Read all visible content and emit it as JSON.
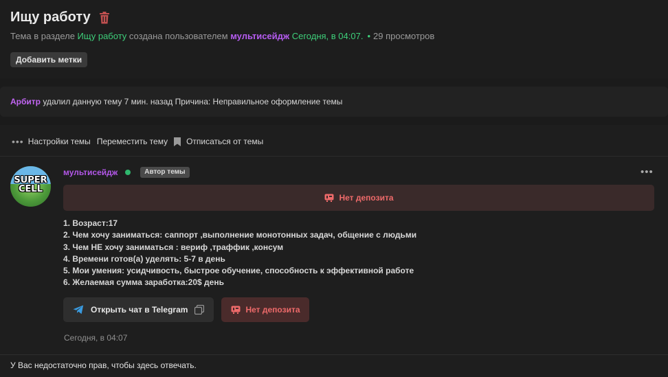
{
  "thread": {
    "title": "Ищу работу",
    "meta": {
      "prefix": "Тема в разделе ",
      "section": "Ищу работу",
      "created_by": " создана пользователем ",
      "author": "мультисейдж",
      "time": " Сегодня, в 04:07.",
      "views": "29 просмотров"
    },
    "add_tags_label": "Добавить метки"
  },
  "notice": {
    "moderator": "Арбитр",
    "text": " удалил данную тему 7 мин. назад Причина: Неправильное оформление темы"
  },
  "toolbar": {
    "settings_label": "Настройки темы",
    "move_label": "Переместить тему",
    "unsubscribe_label": "Отписаться от темы"
  },
  "post": {
    "author": "мультисейдж",
    "avatar_text": "SUPER CELL",
    "badge": "Автор темы",
    "deposit_banner": "Нет депозита",
    "lines": [
      "1. Возраст:17",
      "2. Чем хочу заниматься: саппорт ,выполнение монотонных задач, общение с людьми",
      "3. Чем НЕ хочу заниматься : вериф ,траффик ,консум",
      "4. Времени готов(а) уделять: 5-7 в день",
      "5. Мои умения: усидчивость, быстрое обучение, способность к эффективной работе",
      "6. Желаемая сумма заработка:20$ день"
    ],
    "telegram_button": "Открыть чат в Telegram",
    "deposit_button": "Нет депозита",
    "date": "Сегодня, в 04:07"
  },
  "footer": {
    "text": "У Вас недостаточно прав, чтобы здесь отвечать."
  },
  "colors": {
    "accent_purple": "#b357e8",
    "accent_green": "#3ecf7a",
    "deposit_red": "#ee6a6a"
  }
}
